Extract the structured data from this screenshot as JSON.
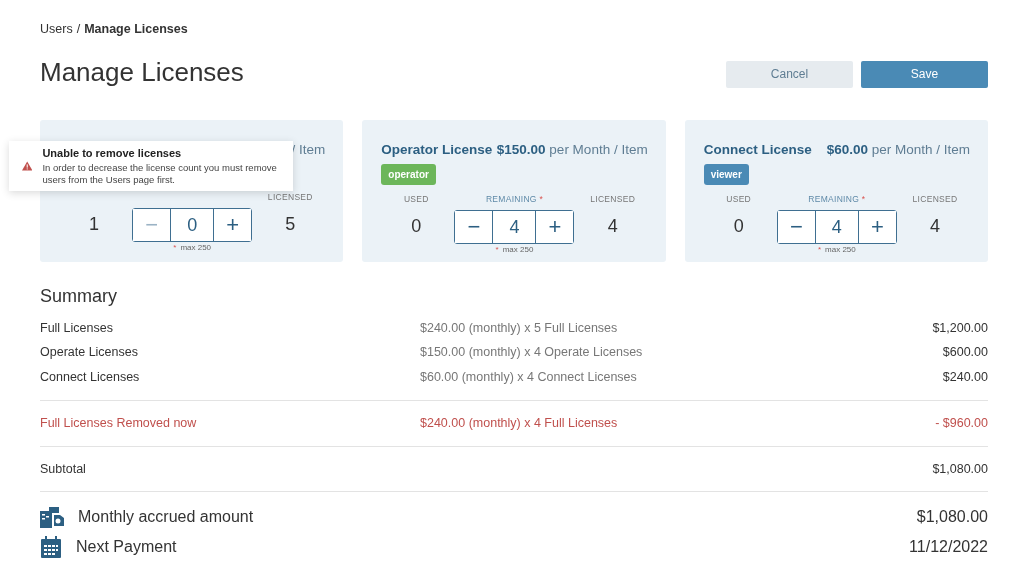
{
  "breadcrumb": {
    "parent": "Users",
    "separator": "/",
    "current": "Manage Licenses"
  },
  "page_title": "Manage Licenses",
  "buttons": [
    {
      "label": "Cancel",
      "kind": "secondary"
    },
    {
      "label": "Save",
      "kind": "primary"
    }
  ],
  "licenses": [
    {
      "unit": "/ Item",
      "licensed_label": "LICENSED",
      "used": "1",
      "remaining": "0",
      "licensed": "5",
      "decrease_disabled": true,
      "minus": "−",
      "plus": "+",
      "hint_mark": "*",
      "hint": "max 250"
    },
    {
      "name": "Operator License",
      "price": "$150.00",
      "unit": "per Month / Item",
      "badges": [
        {
          "label": "operator",
          "color": "#6cb65a"
        }
      ],
      "used_label": "USED",
      "remaining_label": "REMAINING",
      "required_mark": "*",
      "licensed_label": "LICENSED",
      "used": "0",
      "remaining": "4",
      "licensed": "4",
      "decrease_disabled": false,
      "minus": "−",
      "plus": "+",
      "hint_mark": "*",
      "hint": "max 250"
    },
    {
      "name": "Connect License",
      "price": "$60.00",
      "unit": "per Month / Item",
      "badges": [
        {
          "label": "viewer",
          "color": "#4a8ab5"
        }
      ],
      "used_label": "USED",
      "remaining_label": "REMAINING",
      "required_mark": "*",
      "licensed_label": "LICENSED",
      "used": "0",
      "remaining": "4",
      "licensed": "4",
      "decrease_disabled": false,
      "minus": "−",
      "plus": "+",
      "hint_mark": "*",
      "hint": "max 250"
    }
  ],
  "toast": {
    "title": "Unable to remove licenses",
    "message": "In order to decrease the license count you must remove users from the Users page first."
  },
  "summary": {
    "title": "Summary",
    "rows": [
      {
        "kind": "line",
        "label": "Full Licenses",
        "detail": "$240.00 (monthly) x 5 Full Licenses",
        "amount": "$1,200.00"
      },
      {
        "kind": "line",
        "label": "Operate Licenses",
        "detail": "$150.00 (monthly) x 4 Operate Licenses",
        "amount": "$600.00"
      },
      {
        "kind": "line",
        "label": "Connect Licenses",
        "detail": "$60.00 (monthly) x 4 Connect Licenses",
        "amount": "$240.00"
      },
      {
        "kind": "removed",
        "label": "Full Licenses Removed now",
        "detail": "$240.00 (monthly) x 4 Full Licenses",
        "amount": "- $960.00"
      },
      {
        "kind": "subtotal",
        "label": "Subtotal",
        "amount": "$1,080.00"
      }
    ],
    "totals": [
      {
        "kind": "accrued",
        "label": "Monthly accrued amount",
        "value": "$1,080.00"
      },
      {
        "kind": "payment",
        "label": "Next Payment",
        "value": "11/12/2022"
      }
    ]
  }
}
